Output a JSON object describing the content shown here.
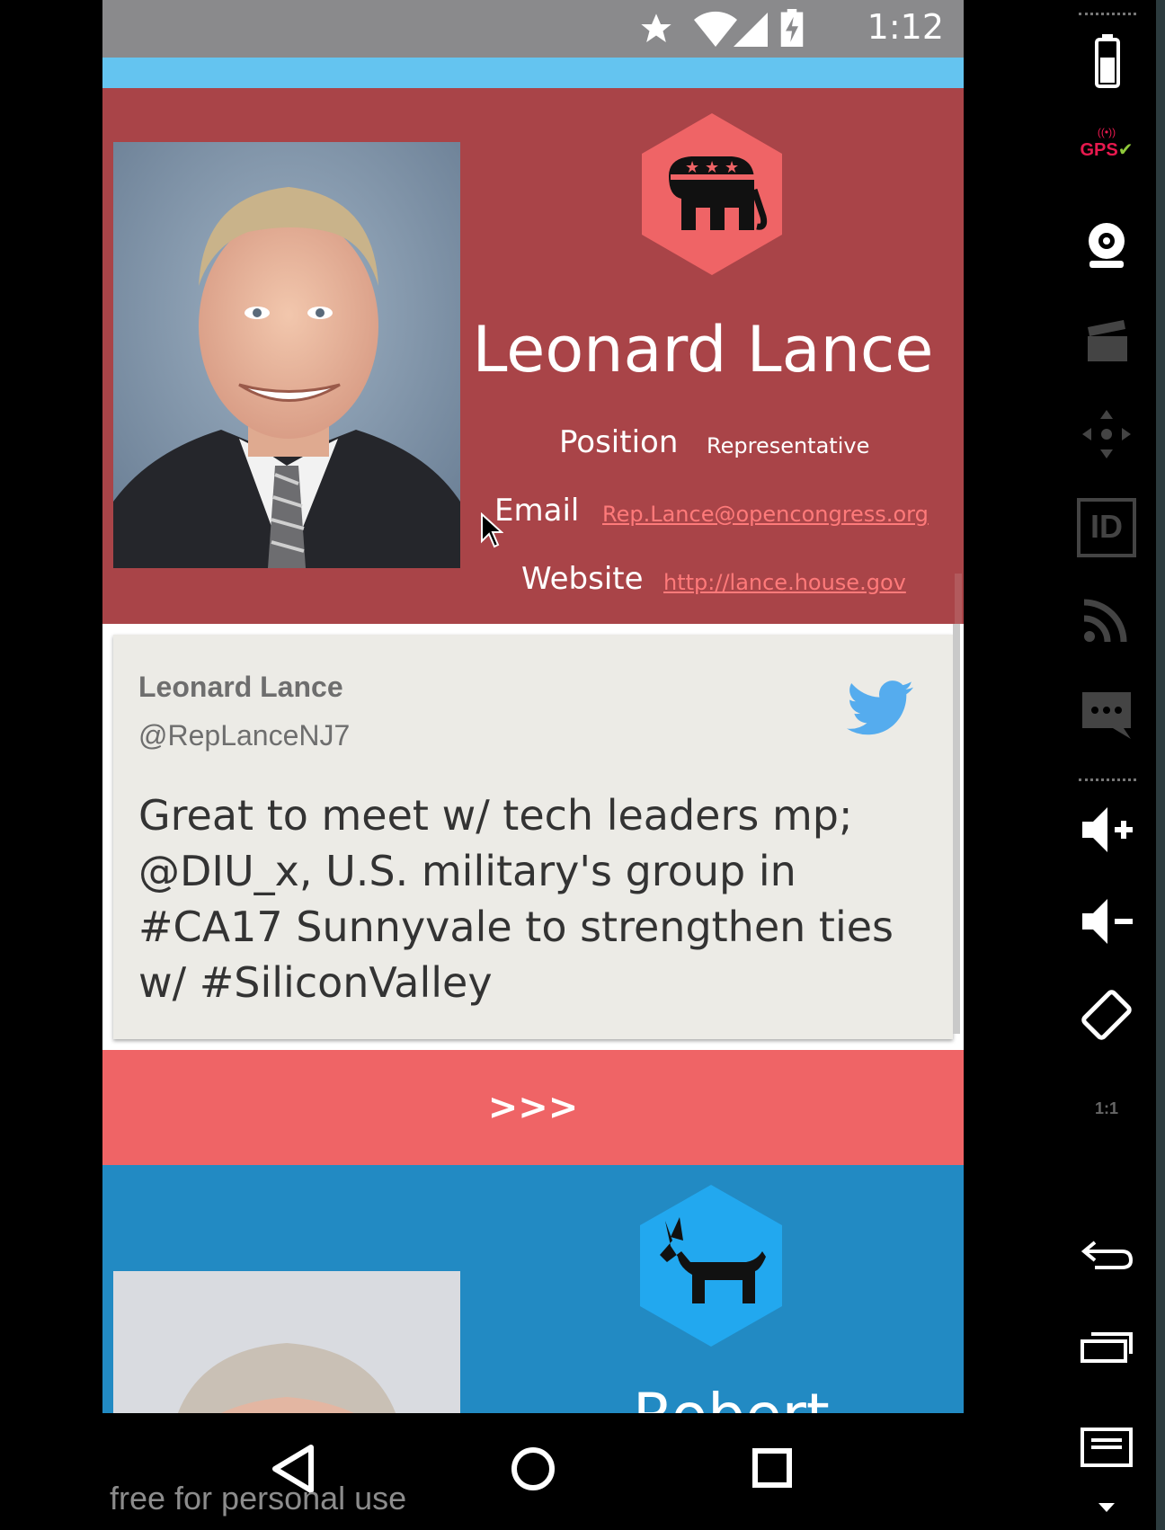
{
  "status_bar": {
    "time": "1:12"
  },
  "rep": {
    "name": "Leonard Lance",
    "position_label": "Position",
    "position_value": "Representative",
    "email_label": "Email",
    "email_value": "Rep.Lance@opencongress.org",
    "website_label": "Website",
    "website_value": "http://lance.house.gov",
    "party": "republican-elephant-icon",
    "card_color": "#a94448"
  },
  "tweet": {
    "author": "Leonard Lance",
    "handle": "@RepLanceNJ7",
    "text": "Great to meet w/ tech leaders mp; @DIU_x, U.S. military's group in #CA17 Sunnyvale to strengthen ties w/ #SiliconValley"
  },
  "next_button": {
    "label": ">>>",
    "color": "#ef6466"
  },
  "next_rep": {
    "name_partial": "Robert",
    "party": "democrat-donkey-icon",
    "card_color": "#228ac3"
  },
  "watermark": "free for personal use",
  "sidebar": {
    "gps_label": "GPS",
    "id_label": "ID",
    "scale_label": "1:1",
    "items": [
      "battery-icon",
      "gps-icon",
      "webcam-icon",
      "clapper-icon",
      "dpad-icon",
      "id-icon",
      "rss-icon",
      "sms-icon",
      "volume-up-icon",
      "volume-down-icon",
      "rotate-icon",
      "scale-icon",
      "back-icon",
      "recents-icon",
      "menu-icon"
    ]
  }
}
